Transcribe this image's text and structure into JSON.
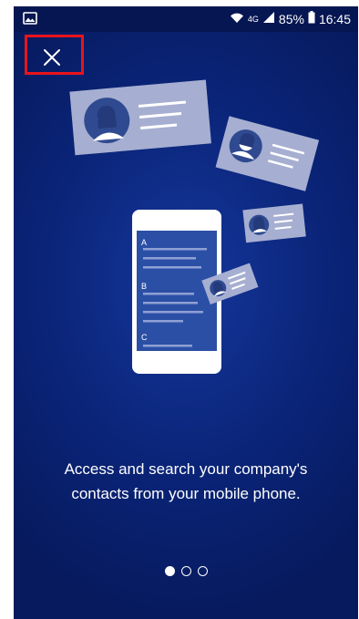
{
  "status_bar": {
    "network": "4G",
    "battery": "85%",
    "time": "16:45",
    "icons": [
      "image-notification-icon",
      "wifi-icon",
      "signal-icon",
      "battery-icon"
    ]
  },
  "contact_list": {
    "letters": [
      "A",
      "B",
      "C"
    ]
  },
  "onboarding": {
    "message_line1": "Access and search your company's",
    "message_line2": "contacts from your mobile phone.",
    "page_count": 3,
    "active_page": 1
  },
  "colors": {
    "background": "#0a2478",
    "highlight_border": "#e8141c",
    "card": "#a6afd1"
  }
}
